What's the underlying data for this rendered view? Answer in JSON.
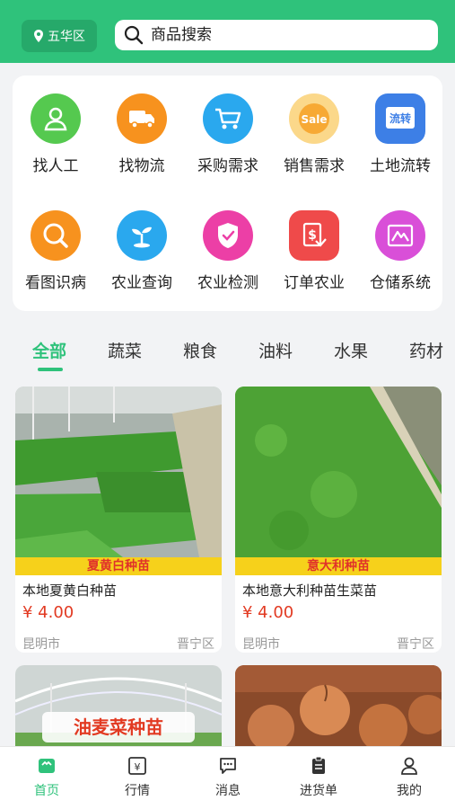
{
  "header": {
    "location_label": "五华区",
    "search_placeholder": "商品搜索"
  },
  "grid": [
    {
      "label": "找人工",
      "icon": "person-icon",
      "color": "#55c94f"
    },
    {
      "label": "找物流",
      "icon": "truck-icon",
      "color": "#f7921e"
    },
    {
      "label": "采购需求",
      "icon": "cart-icon",
      "color": "#2aa8ee"
    },
    {
      "label": "销售需求",
      "icon": "sale-badge-icon",
      "color": "#f7a934"
    },
    {
      "label": "土地流转",
      "icon": "land-transfer-icon",
      "color": "#3d7fe6"
    },
    {
      "label": "看图识病",
      "icon": "magnifier-icon",
      "color": "#f7921e"
    },
    {
      "label": "农业查询",
      "icon": "sprout-icon",
      "color": "#2aa8ee"
    },
    {
      "label": "农业检测",
      "icon": "shield-check-icon",
      "color": "#ec3fa6"
    },
    {
      "label": "订单农业",
      "icon": "order-money-icon",
      "color": "#ef4a4a"
    },
    {
      "label": "仓储系统",
      "icon": "warehouse-icon",
      "color": "#d94fd8"
    }
  ],
  "tabs": [
    "全部",
    "蔬菜",
    "粮食",
    "油料",
    "水果",
    "药材"
  ],
  "products": [
    {
      "ribbon": "夏黄白种苗",
      "name": "本地夏黄白种苗",
      "price": "¥ 4.00",
      "city": "昆明市",
      "district": "晋宁区"
    },
    {
      "ribbon": "意大利种苗",
      "name": "本地意大利种苗生菜苗",
      "price": "¥ 4.00",
      "city": "昆明市",
      "district": "晋宁区"
    },
    {
      "overlay": "油麦菜种苗"
    },
    {}
  ],
  "tabbar": [
    {
      "label": "首页",
      "icon": "home-icon"
    },
    {
      "label": "行情",
      "icon": "market-icon"
    },
    {
      "label": "消息",
      "icon": "message-icon"
    },
    {
      "label": "进货单",
      "icon": "clipboard-icon"
    },
    {
      "label": "我的",
      "icon": "user-icon"
    }
  ],
  "colors": {
    "accent": "#2fc27b",
    "price": "#e23a22",
    "ribbon": "#f6d11b"
  }
}
